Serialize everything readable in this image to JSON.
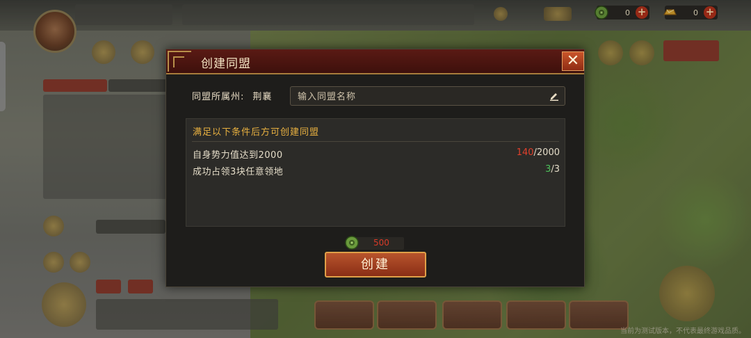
{
  "currency": {
    "coins": {
      "value": "0",
      "icon": "jade-coin-icon"
    },
    "gold": {
      "value": "0",
      "icon": "gold-ingot-icon"
    }
  },
  "dialog": {
    "title": "创建同盟",
    "close_label": "✕",
    "state_label": "同盟所属州:",
    "state_value": "荆襄",
    "name_placeholder": "输入同盟名称",
    "conditions_title": "满足以下条件后方可创建同盟",
    "conditions": [
      {
        "label": "自身势力值达到2000",
        "current": "140",
        "required": "/2000",
        "status": "unmet"
      },
      {
        "label": "成功占领3块任意领地",
        "current": "3",
        "required": "/3",
        "status": "met"
      }
    ],
    "cost": "500",
    "create_label": "创建"
  },
  "watermark": "当前为测试版本，不代表最终游戏品质。",
  "colors": {
    "header": "#5a1a14",
    "accent_gold": "#e8b040",
    "unmet": "#e0402c",
    "met": "#4cc05a",
    "button": "#b8542c"
  }
}
